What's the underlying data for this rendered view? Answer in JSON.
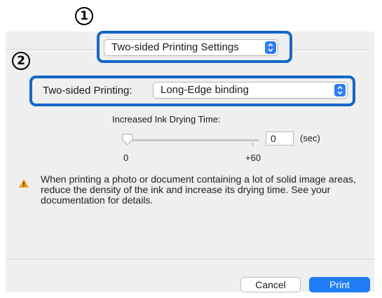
{
  "callouts": {
    "one": "1",
    "two": "2"
  },
  "panel_popup": {
    "value": "Two-sided Printing Settings"
  },
  "two_sided": {
    "label": "Two-sided Printing:",
    "value": "Long-Edge binding"
  },
  "drying": {
    "label": "Increased Ink Drying Time:",
    "value": "0",
    "unit": "(sec)",
    "min_label": "0",
    "max_label": "+60",
    "slider_fraction": 0
  },
  "warning": {
    "icon": "warning-triangle-icon",
    "text": "When printing a photo or document containing a lot of solid image areas, reduce the density of the ink and increase its drying time. See your documentation for details."
  },
  "buttons": {
    "cancel": "Cancel",
    "print": "Print"
  },
  "colors": {
    "accent": "#1f7cf4",
    "callout_frame": "#1667c7",
    "warning": "#e8a21a"
  }
}
